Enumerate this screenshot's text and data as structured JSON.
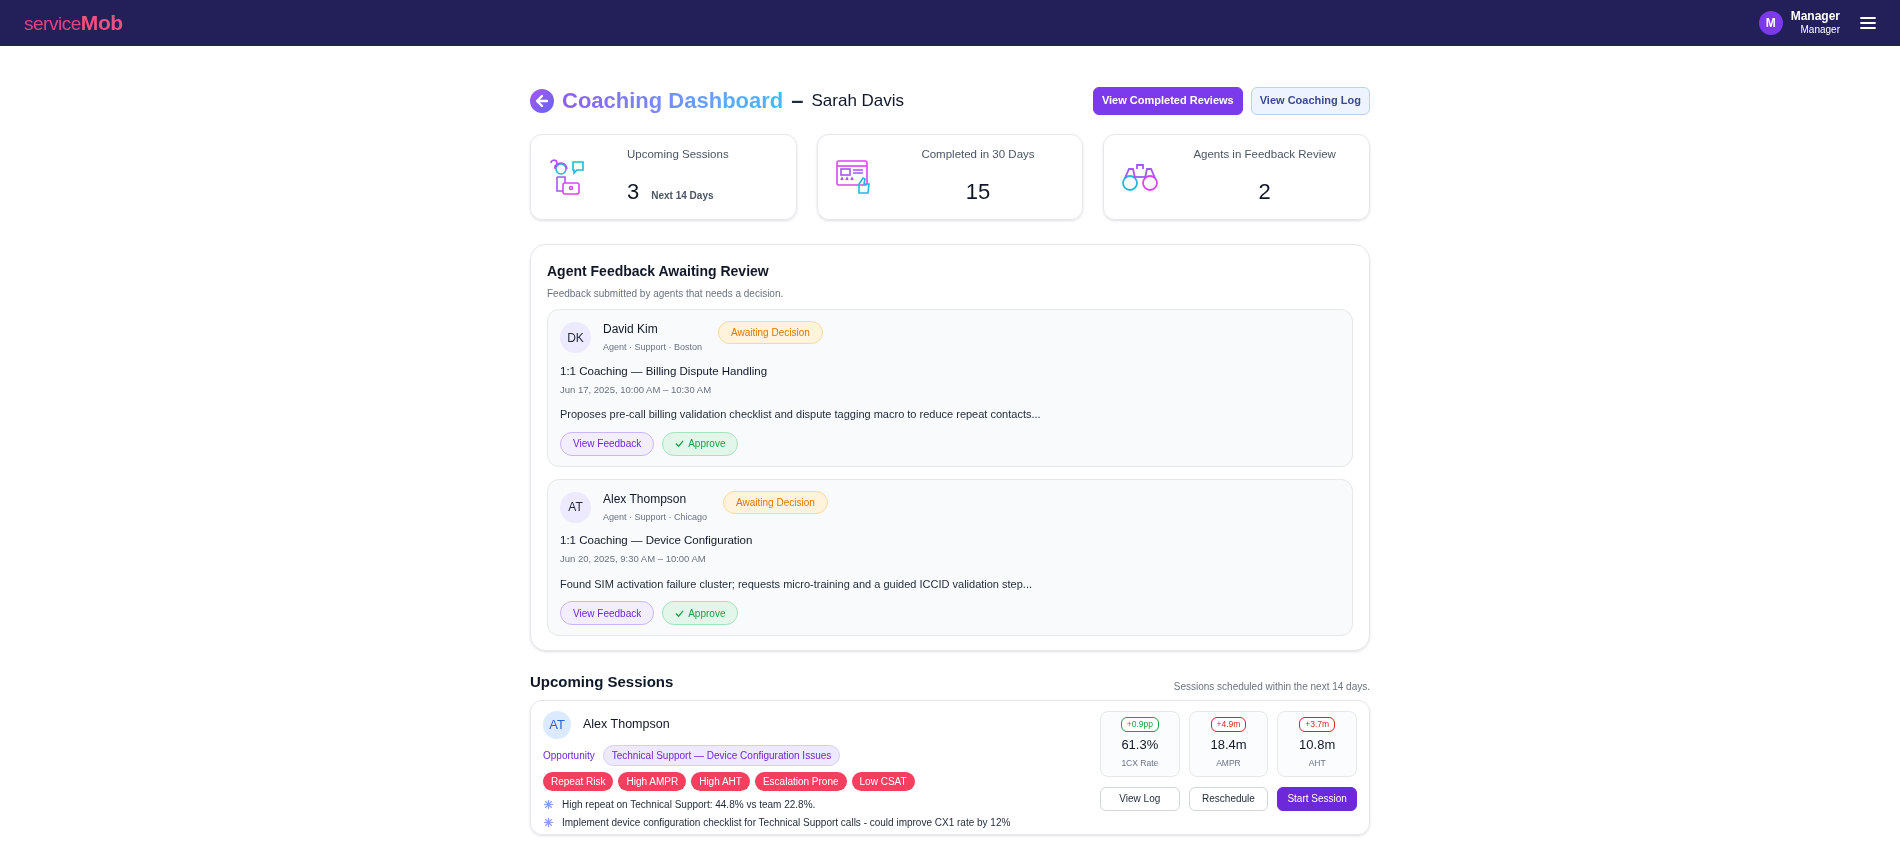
{
  "header": {
    "logo": {
      "lead": "service",
      "tail": "Mob"
    },
    "user": {
      "initial": "M",
      "name": "Manager",
      "role": "Manager"
    }
  },
  "page": {
    "title": "Coaching Dashboard",
    "separator": "–",
    "subject": "Sarah Davis",
    "buttons": [
      {
        "label": "View Completed Reviews",
        "kind": "primary"
      },
      {
        "label": "View Coaching Log",
        "kind": "secondary"
      }
    ]
  },
  "stats": [
    {
      "label": "Upcoming Sessions",
      "value": "3",
      "note": "Next 14 Days"
    },
    {
      "label": "Completed in 30 Days",
      "value": "15"
    },
    {
      "label": "Agents in Feedback Review",
      "value": "2"
    }
  ],
  "feedback": {
    "title": "Agent Feedback Awaiting Review",
    "subtitle": "Feedback submitted by agents that needs a decision.",
    "items": [
      {
        "initials": "DK",
        "name": "David Kim",
        "meta": "Agent · Support · Boston",
        "status": "Awaiting Decision",
        "session": "1:1 Coaching — Billing Dispute Handling",
        "time": "Jun 17, 2025, 10:00 AM – 10:30 AM",
        "summary": "Proposes pre-call billing validation checklist and dispute tagging macro to reduce repeat contacts...",
        "actions": [
          {
            "label": "View Feedback",
            "kind": "view"
          },
          {
            "label": "Approve",
            "kind": "approve"
          }
        ]
      },
      {
        "initials": "AT",
        "name": "Alex Thompson",
        "meta": "Agent · Support · Chicago",
        "status": "Awaiting Decision",
        "session": "1:1 Coaching — Device Configuration",
        "time": "Jun 20, 2025, 9:30 AM – 10:00 AM",
        "summary": "Found SIM activation failure cluster; requests micro-training and a guided ICCID validation step...",
        "actions": [
          {
            "label": "View Feedback",
            "kind": "view"
          },
          {
            "label": "Approve",
            "kind": "approve"
          }
        ]
      }
    ]
  },
  "upcoming": {
    "title": "Upcoming Sessions",
    "caption": "Sessions scheduled within the next 14 days.",
    "sessions": [
      {
        "initials": "AT",
        "name": "Alex Thompson",
        "opportunity_label": "Opportunity",
        "opportunity": "Technical Support — Device Configuration Issues",
        "tags": [
          "Repeat Risk",
          "High AMPR",
          "High AHT",
          "Escalation Prone",
          "Low CSAT"
        ],
        "notes": [
          "High repeat on Technical Support: 44.8% vs team 22.8%.",
          "Implement device configuration checklist for Technical Support calls - could improve CX1 rate by 12%"
        ],
        "metrics": [
          {
            "delta": "+0.9pp",
            "color": "#16a34a",
            "value": "61.3%",
            "label": "1CX Rate"
          },
          {
            "delta": "+4.9m",
            "color": "#dc2626",
            "value": "18.4m",
            "label": "AMPR"
          },
          {
            "delta": "+3.7m",
            "color": "#dc2626",
            "value": "10.8m",
            "label": "AHT"
          }
        ],
        "actions": [
          {
            "label": "View Log",
            "kind": "outline"
          },
          {
            "label": "Reschedule",
            "kind": "outline"
          },
          {
            "label": "Start Session",
            "kind": "primary"
          }
        ]
      }
    ]
  }
}
